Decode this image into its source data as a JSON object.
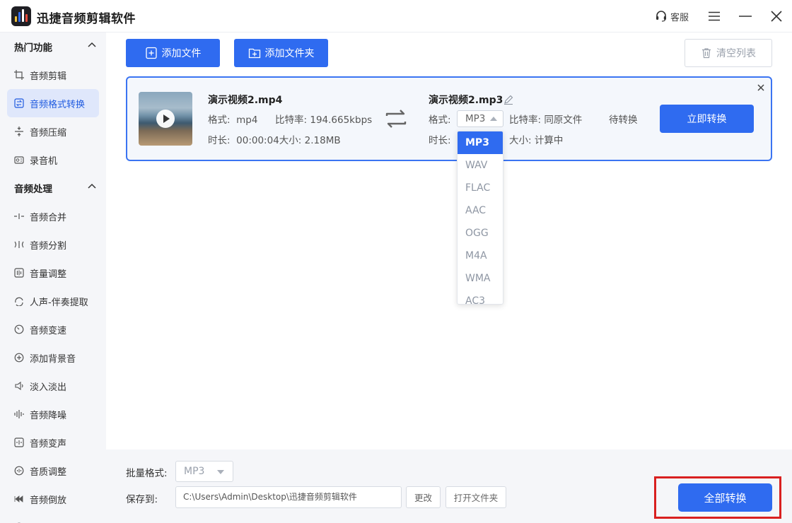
{
  "app": {
    "title": "迅捷音频剪辑软件",
    "service_label": "客服"
  },
  "window_icons": [
    "menu-icon",
    "minimize-icon",
    "close-icon"
  ],
  "sidebar": {
    "groups": [
      {
        "title": "热门功能",
        "items": [
          {
            "label": "音频剪辑",
            "icon": "crop-icon"
          },
          {
            "label": "音频格式转换",
            "icon": "format-convert-icon",
            "active": true
          },
          {
            "label": "音频压缩",
            "icon": "compress-icon"
          },
          {
            "label": "录音机",
            "icon": "recorder-icon"
          }
        ]
      },
      {
        "title": "音频处理",
        "items": [
          {
            "label": "音频合并",
            "icon": "merge-icon"
          },
          {
            "label": "音频分割",
            "icon": "split-icon"
          },
          {
            "label": "音量调整",
            "icon": "volume-icon"
          },
          {
            "label": "人声-伴奏提取",
            "icon": "vocal-icon"
          },
          {
            "label": "音频变速",
            "icon": "speed-icon"
          },
          {
            "label": "添加背景音",
            "icon": "bgm-icon"
          },
          {
            "label": "淡入淡出",
            "icon": "fade-icon"
          },
          {
            "label": "音频降噪",
            "icon": "denoise-icon"
          },
          {
            "label": "音频变声",
            "icon": "voice-change-icon"
          },
          {
            "label": "音质调整",
            "icon": "quality-icon"
          },
          {
            "label": "音频倒放",
            "icon": "reverse-icon"
          },
          {
            "label": "",
            "icon": "more-icon"
          }
        ]
      }
    ]
  },
  "toolbar": {
    "add_file": "添加文件",
    "add_folder": "添加文件夹",
    "clear_list": "清空列表"
  },
  "file": {
    "source_name": "演示视频2.mp4",
    "source_format_label": "格式:",
    "source_format": "mp4",
    "source_bitrate_label": "比特率:",
    "source_bitrate": "194.665kbps",
    "duration_label": "时长:",
    "duration": "00:00:04",
    "size_label": "大小:",
    "size": "2.18MB",
    "target_name": "演示视频2.mp3",
    "target_format_label": "格式:",
    "target_format": "MP3",
    "target_bitrate_label": "比特率:",
    "target_bitrate": "同原文件",
    "target_duration_label": "时长:",
    "target_size_label": "大小:",
    "target_size": "计算中",
    "status": "待转换",
    "convert_now": "立即转换"
  },
  "format_dropdown": {
    "options": [
      "MP3",
      "WAV",
      "FLAC",
      "AAC",
      "OGG",
      "M4A",
      "WMA",
      "AC3"
    ],
    "selected": "MP3"
  },
  "bottom": {
    "batch_format_label": "批量格式:",
    "batch_format": "MP3",
    "save_to_label": "保存到:",
    "save_path": "C:\\Users\\Admin\\Desktop\\迅捷音频剪辑软件",
    "change_btn": "更改",
    "open_folder_btn": "打开文件夹",
    "convert_all": "全部转换"
  },
  "colors": {
    "accent": "#2f6bf0",
    "highlight": "#d92020",
    "sidebar_bg": "#f5f6f9"
  }
}
